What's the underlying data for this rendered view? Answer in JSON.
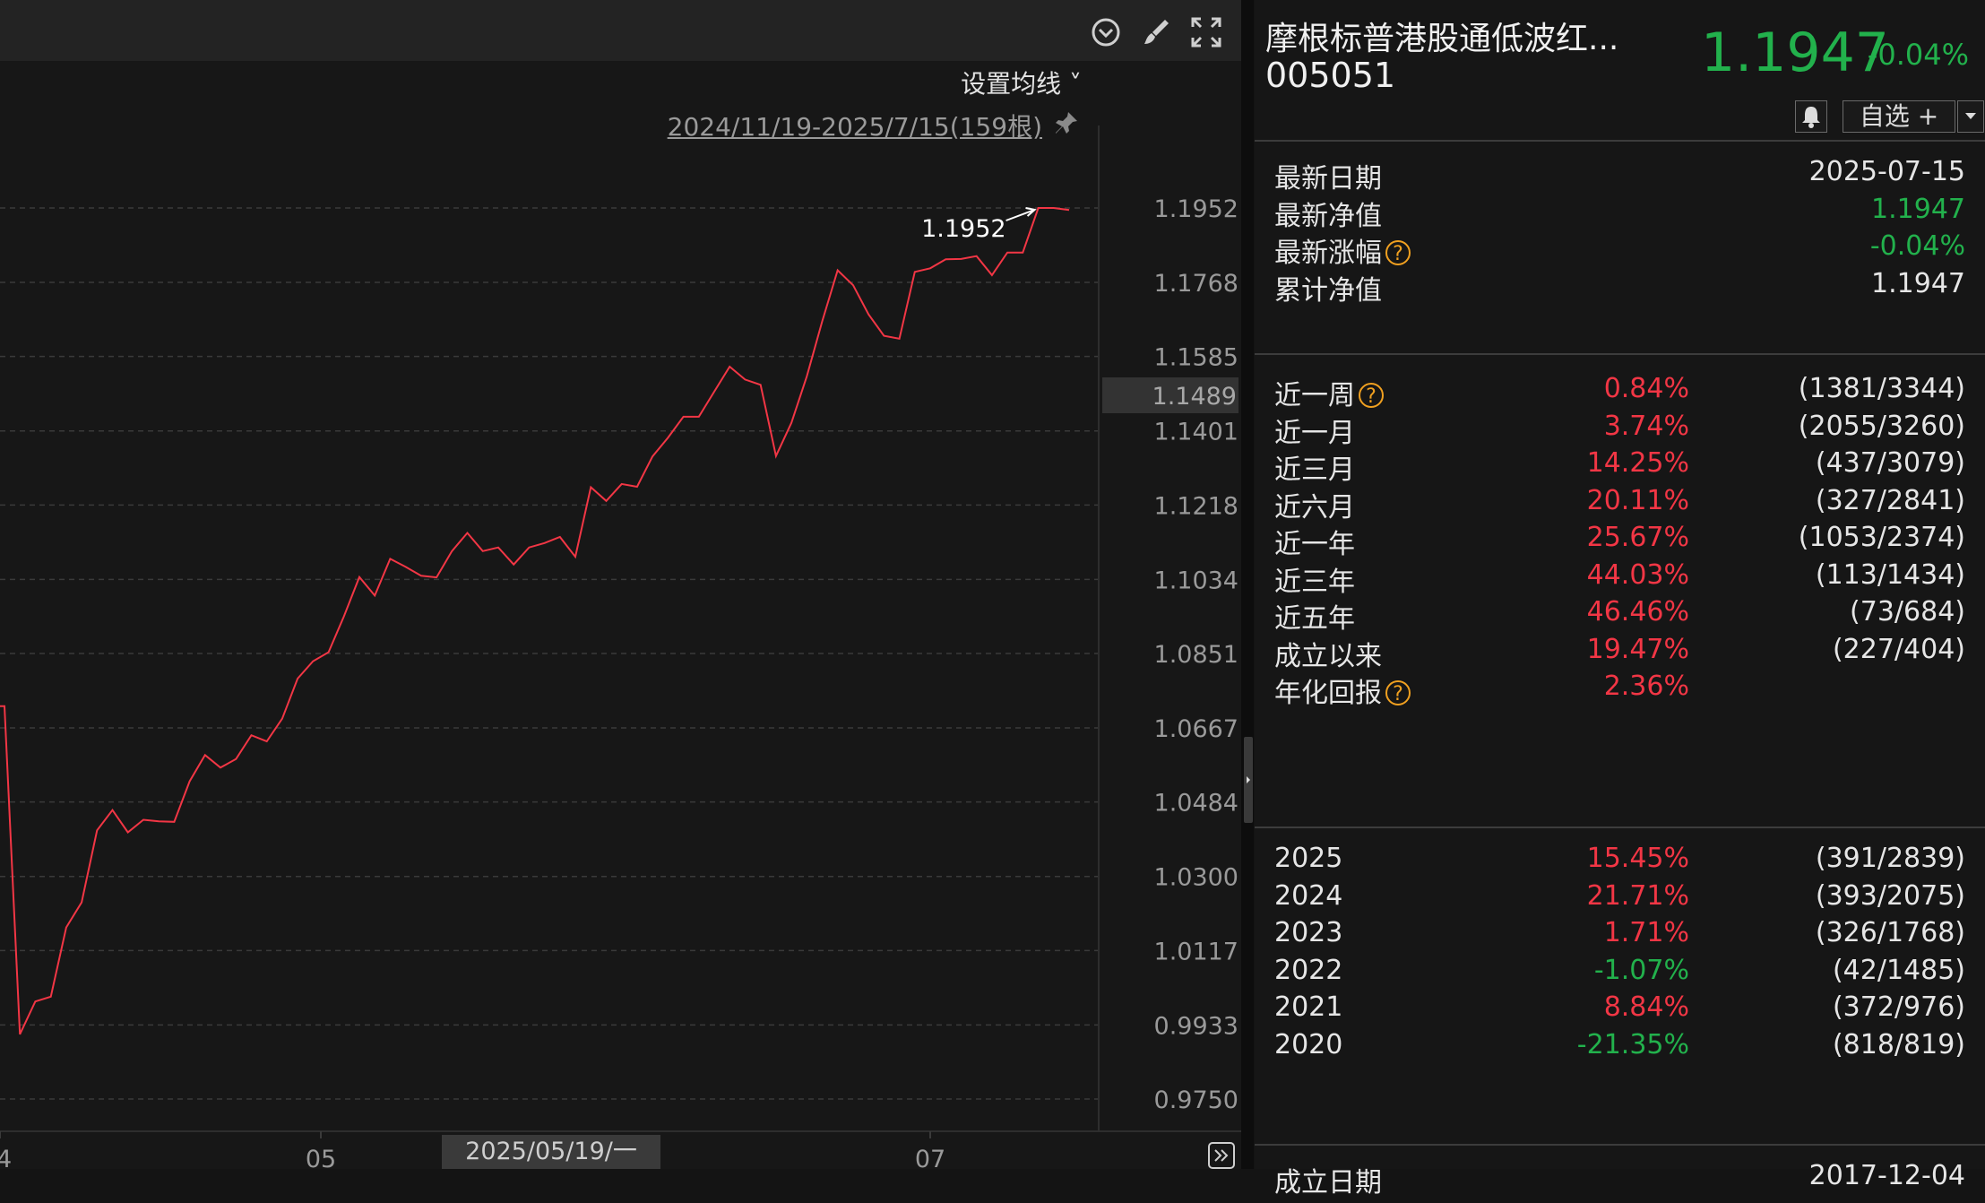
{
  "toolbar": {
    "icons": [
      "chevron-down-circle-icon",
      "brush-icon",
      "fullscreen-icon"
    ]
  },
  "chart_controls": {
    "ma_setting": "设置均线",
    "range": "2024/11/19-2025/7/15(159根)",
    "current_date": "2025/05/19/一"
  },
  "chart_data": {
    "type": "line",
    "yticks": [
      "1.1952",
      "1.1768",
      "1.1585",
      "1.1401",
      "1.1218",
      "1.1034",
      "1.0851",
      "1.0667",
      "1.0484",
      "1.0300",
      "1.0117",
      "0.9933",
      "0.9750"
    ],
    "ylim": [
      0.975,
      1.1952
    ],
    "xticks": [
      "4",
      "05",
      "07"
    ],
    "current_value_label": "1.1489",
    "current_value": 1.1489,
    "annotation": "1.1952",
    "series_color": "#f23645",
    "values": [
      1.0721,
      0.991,
      0.9991,
      1.0003,
      1.0174,
      1.0236,
      1.0414,
      1.0464,
      1.0409,
      1.044,
      1.0436,
      1.0435,
      1.0535,
      1.06,
      1.0569,
      1.059,
      1.0649,
      1.0634,
      1.069,
      1.0789,
      1.0832,
      1.0854,
      1.0943,
      1.104,
      1.0994,
      1.1085,
      1.1065,
      1.1043,
      1.1039,
      1.1104,
      1.1149,
      1.1104,
      1.1113,
      1.1071,
      1.1113,
      1.1124,
      1.1139,
      1.109,
      1.1262,
      1.1228,
      1.127,
      1.1263,
      1.1338,
      1.1384,
      1.1436,
      1.1436,
      1.1498,
      1.156,
      1.1528,
      1.1515,
      1.1339,
      1.1421,
      1.1536,
      1.1672,
      1.1798,
      1.1761,
      1.1689,
      1.1636,
      1.1629,
      1.1794,
      1.1803,
      1.1825,
      1.1826,
      1.1833,
      1.1786,
      1.1842,
      1.1842,
      1.1952,
      1.1952,
      1.1947
    ]
  },
  "fund": {
    "name": "摩根标普港股通低波红...",
    "code": "005051",
    "nav": "1.1947",
    "change": "-0.04%",
    "watch_label": "自选 +"
  },
  "summary": [
    {
      "label": "最新日期",
      "value": "2025-07-15"
    },
    {
      "label": "最新净值",
      "value": "1.1947"
    },
    {
      "label": "最新涨幅",
      "value": "-0.04%"
    },
    {
      "label": "累计净值",
      "value": "1.1947"
    }
  ],
  "periods": [
    {
      "label": "近一周",
      "pct": "0.84%",
      "rank": "(1381/3344)"
    },
    {
      "label": "近一月",
      "pct": "3.74%",
      "rank": "(2055/3260)"
    },
    {
      "label": "近三月",
      "pct": "14.25%",
      "rank": "(437/3079)"
    },
    {
      "label": "近六月",
      "pct": "20.11%",
      "rank": "(327/2841)"
    },
    {
      "label": "近一年",
      "pct": "25.67%",
      "rank": "(1053/2374)"
    },
    {
      "label": "近三年",
      "pct": "44.03%",
      "rank": "(113/1434)"
    },
    {
      "label": "近五年",
      "pct": "46.46%",
      "rank": "(73/684)"
    },
    {
      "label": "成立以来",
      "pct": "19.47%",
      "rank": "(227/404)"
    },
    {
      "label": "年化回报",
      "pct": "2.36%",
      "rank": ""
    }
  ],
  "years": [
    {
      "label": "2025",
      "pct": "15.45%",
      "rank": "(391/2839)"
    },
    {
      "label": "2024",
      "pct": "21.71%",
      "rank": "(393/2075)"
    },
    {
      "label": "2023",
      "pct": "1.71%",
      "rank": "(326/1768)"
    },
    {
      "label": "2022",
      "pct": "-1.07%",
      "rank": "(42/1485)"
    },
    {
      "label": "2021",
      "pct": "8.84%",
      "rank": "(372/976)"
    },
    {
      "label": "2020",
      "pct": "-21.35%",
      "rank": "(818/819)"
    }
  ],
  "footer_partial": {
    "label": "成立日期",
    "value": "2017-12-04"
  },
  "colors": {
    "up": "#f23645",
    "down": "#22b14c",
    "help": "#f0a020"
  }
}
